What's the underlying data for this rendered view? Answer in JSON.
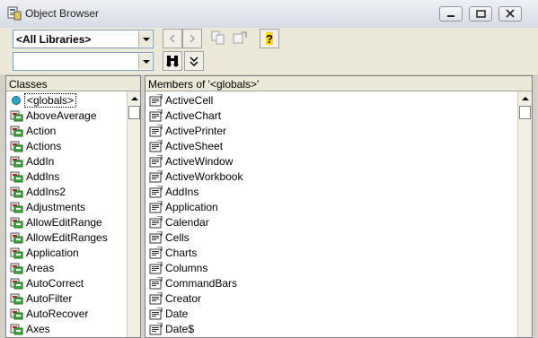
{
  "window": {
    "title": "Object Browser"
  },
  "toolbar": {
    "library_value": "<All Libraries>",
    "search_value": "",
    "icons": [
      "back-icon",
      "forward-icon",
      "copy-icon",
      "view-definition-icon",
      "help-icon",
      "search-binoculars-icon",
      "toggle-results-icon"
    ]
  },
  "classes": {
    "header": "Classes",
    "items": [
      {
        "label": "<globals>",
        "icon": "globals-icon"
      },
      {
        "label": "AboveAverage",
        "icon": "class-icon"
      },
      {
        "label": "Action",
        "icon": "class-icon"
      },
      {
        "label": "Actions",
        "icon": "class-icon"
      },
      {
        "label": "AddIn",
        "icon": "class-icon"
      },
      {
        "label": "AddIns",
        "icon": "class-icon"
      },
      {
        "label": "AddIns2",
        "icon": "class-icon"
      },
      {
        "label": "Adjustments",
        "icon": "class-icon"
      },
      {
        "label": "AllowEditRange",
        "icon": "class-icon"
      },
      {
        "label": "AllowEditRanges",
        "icon": "class-icon"
      },
      {
        "label": "Application",
        "icon": "class-icon"
      },
      {
        "label": "Areas",
        "icon": "class-icon"
      },
      {
        "label": "AutoCorrect",
        "icon": "class-icon"
      },
      {
        "label": "AutoFilter",
        "icon": "class-icon"
      },
      {
        "label": "AutoRecover",
        "icon": "class-icon"
      },
      {
        "label": "Axes",
        "icon": "class-icon"
      }
    ]
  },
  "members": {
    "header": "Members of '<globals>'",
    "items": [
      "ActiveCell",
      "ActiveChart",
      "ActivePrinter",
      "ActiveSheet",
      "ActiveWindow",
      "ActiveWorkbook",
      "AddIns",
      "Application",
      "Calendar",
      "Cells",
      "Charts",
      "Columns",
      "CommandBars",
      "Creator",
      "Date",
      "Date$"
    ]
  },
  "colors": {
    "selection_border": "#000000",
    "panel_bg": "#ffffff",
    "chrome": "#ece9d8"
  }
}
